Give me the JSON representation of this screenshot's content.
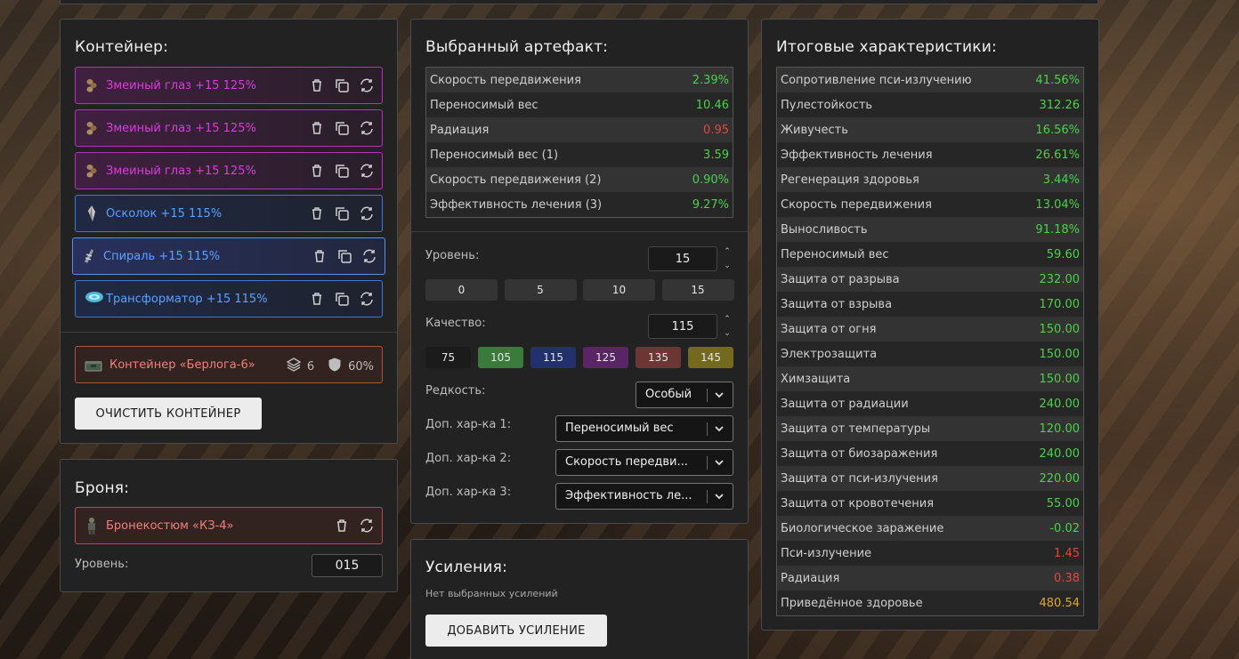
{
  "container": {
    "title": "Контейнер:",
    "artifacts": [
      {
        "label": "Змеиный глаз +15 125%",
        "rarity": "purple",
        "icon": "snake-eye-artifact-icon"
      },
      {
        "label": "Змеиный глаз +15 125%",
        "rarity": "purple",
        "icon": "snake-eye-artifact-icon"
      },
      {
        "label": "Змеиный глаз +15 125%",
        "rarity": "purple",
        "icon": "snake-eye-artifact-icon"
      },
      {
        "label": "Осколок +15 115%",
        "rarity": "blue",
        "icon": "shard-artifact-icon"
      },
      {
        "label": "Спираль +15 115%",
        "rarity": "blue",
        "icon": "spiral-artifact-icon",
        "selected": true
      },
      {
        "label": "Трансформатор +15 115%",
        "rarity": "blue",
        "icon": "transformer-artifact-icon"
      }
    ],
    "container_item": {
      "label": "Контейнер «Берлога-6»",
      "slots": "6",
      "protection": "60%"
    },
    "clear_button": "ОЧИСТИТЬ КОНТЕЙНЕР"
  },
  "armor": {
    "title": "Броня:",
    "item": {
      "label": "Бронекостюм «КЗ-4»"
    },
    "level_label": "Уровень:",
    "level_value": "015"
  },
  "artifact": {
    "title": "Выбранный артефакт:",
    "stats": [
      {
        "name": "Скорость передвижения",
        "value": "2.39%",
        "tone": "green"
      },
      {
        "name": "Переносимый вес",
        "value": "10.46",
        "tone": "green"
      },
      {
        "name": "Радиация",
        "value": "0.95",
        "tone": "red"
      },
      {
        "name": "Переносимый вес (1)",
        "value": "3.59",
        "tone": "green"
      },
      {
        "name": "Скорость передвижения (2)",
        "value": "0.90%",
        "tone": "green"
      },
      {
        "name": "Эффективность лечения (3)",
        "value": "9.27%",
        "tone": "green"
      }
    ],
    "level_label": "Уровень:",
    "level_value": "15",
    "level_presets": [
      "0",
      "5",
      "10",
      "15"
    ],
    "quality_label": "Качество:",
    "quality_value": "115",
    "quality_presets": [
      {
        "label": "75",
        "color": "#1b1b1b"
      },
      {
        "label": "105",
        "color": "#3a7a3a"
      },
      {
        "label": "115",
        "color": "#22306e"
      },
      {
        "label": "125",
        "color": "#5a2566"
      },
      {
        "label": "135",
        "color": "#6e3535"
      },
      {
        "label": "145",
        "color": "#736a1e"
      }
    ],
    "rarity_label": "Редкость:",
    "rarity_value": "Особый",
    "extra1_label": "Доп. хар-ка 1:",
    "extra1_value": "Переносимый вес",
    "extra2_label": "Доп. хар-ка 2:",
    "extra2_value": "Скорость передви...",
    "extra3_label": "Доп. хар-ка 3:",
    "extra3_value": "Эффективность ле..."
  },
  "boosts": {
    "title": "Усиления:",
    "empty_text": "Нет выбранных усилений",
    "add_button": "ДОБАВИТЬ УСИЛЕНИЕ"
  },
  "summary": {
    "title": "Итоговые характеристики:",
    "stats": [
      {
        "name": "Сопротивление пси-излучению",
        "value": "41.56%",
        "tone": "green"
      },
      {
        "name": "Пулестойкость",
        "value": "312.26",
        "tone": "green"
      },
      {
        "name": "Живучесть",
        "value": "16.56%",
        "tone": "green"
      },
      {
        "name": "Эффективность лечения",
        "value": "26.61%",
        "tone": "green"
      },
      {
        "name": "Регенерация здоровья",
        "value": "3.44%",
        "tone": "green"
      },
      {
        "name": "Скорость передвижения",
        "value": "13.04%",
        "tone": "green"
      },
      {
        "name": "Выносливость",
        "value": "91.18%",
        "tone": "green"
      },
      {
        "name": "Переносимый вес",
        "value": "59.60",
        "tone": "green"
      },
      {
        "name": "Защита от разрыва",
        "value": "232.00",
        "tone": "green"
      },
      {
        "name": "Защита от взрыва",
        "value": "170.00",
        "tone": "green"
      },
      {
        "name": "Защита от огня",
        "value": "150.00",
        "tone": "green"
      },
      {
        "name": "Электрозащита",
        "value": "150.00",
        "tone": "green"
      },
      {
        "name": "Химзащита",
        "value": "150.00",
        "tone": "green"
      },
      {
        "name": "Защита от радиации",
        "value": "240.00",
        "tone": "green"
      },
      {
        "name": "Защита от температуры",
        "value": "120.00",
        "tone": "green"
      },
      {
        "name": "Защита от биозаражения",
        "value": "240.00",
        "tone": "green"
      },
      {
        "name": "Защита от пси-излучения",
        "value": "220.00",
        "tone": "green"
      },
      {
        "name": "Защита от кровотечения",
        "value": "55.00",
        "tone": "green"
      },
      {
        "name": "Биологическое заражение",
        "value": "-0.02",
        "tone": "green"
      },
      {
        "name": "Пси-излучение",
        "value": "1.45",
        "tone": "red"
      },
      {
        "name": "Радиация",
        "value": "0.38",
        "tone": "red"
      },
      {
        "name": "Приведённое здоровье",
        "value": "480.54",
        "tone": "gold"
      }
    ]
  }
}
